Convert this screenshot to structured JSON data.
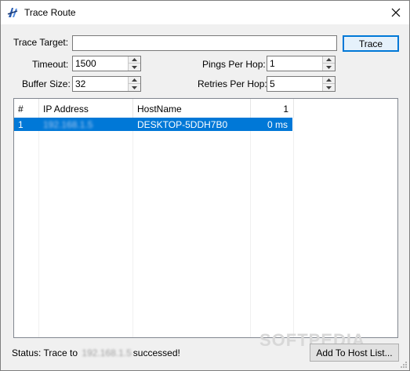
{
  "window": {
    "title": "Trace Route"
  },
  "form": {
    "trace_target_label": "Trace Target:",
    "trace_target_value": "",
    "trace_button": "Trace",
    "timeout_label": "Timeout:",
    "timeout_value": "1500",
    "buffer_label": "Buffer Size:",
    "buffer_value": "32",
    "pings_label": "Pings Per Hop:",
    "pings_value": "1",
    "retries_label": "Retries Per Hop:",
    "retries_value": "5"
  },
  "table": {
    "columns": [
      "#",
      "IP Address",
      "HostName",
      "1"
    ],
    "rows": [
      {
        "num": "1",
        "ip": "192.168.1.5",
        "host": "DESKTOP-5DDH7B0",
        "time": "0 ms"
      }
    ]
  },
  "status": {
    "prefix": "Status: Trace to",
    "ip": "192.168.1.5",
    "suffix": "successed!"
  },
  "add_button": "Add To Host List...",
  "watermark": "SOFTPEDIA",
  "colors": {
    "selection": "#0078d7",
    "accent": "#0078d7"
  },
  "icons": {
    "app": "trace-route-icon",
    "close": "close-icon"
  }
}
